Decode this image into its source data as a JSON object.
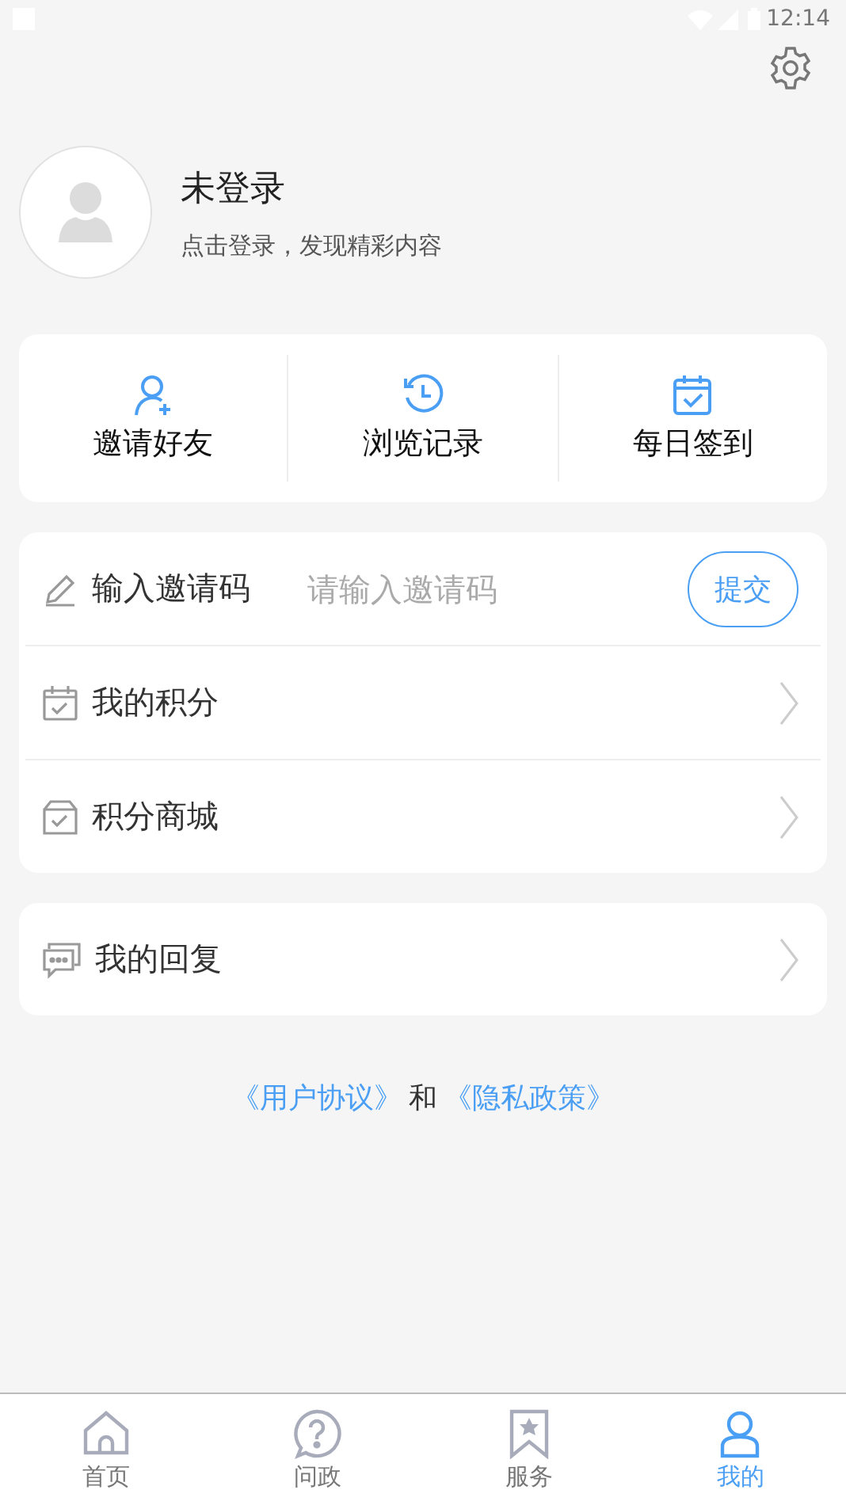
{
  "status_bar": {
    "time": "12:14"
  },
  "profile": {
    "name": "未登录",
    "subtitle": "点击登录，发现精彩内容"
  },
  "quick_actions": [
    {
      "label": "邀请好友"
    },
    {
      "label": "浏览记录"
    },
    {
      "label": "每日签到"
    }
  ],
  "menu_groups": [
    [
      {
        "kind": "input",
        "label": "输入邀请码",
        "placeholder": "请输入邀请码",
        "button": "提交"
      },
      {
        "kind": "link",
        "label": "我的积分"
      },
      {
        "kind": "link",
        "label": "积分商城"
      }
    ],
    [
      {
        "kind": "link",
        "label": "我的回复"
      }
    ]
  ],
  "agreement": {
    "first_link": "《用户协议》",
    "joiner": "和",
    "second_link": "《隐私政策》"
  },
  "tab_bar": [
    {
      "label": "首页",
      "selected": false
    },
    {
      "label": "问政",
      "selected": false
    },
    {
      "label": "服务",
      "selected": false
    },
    {
      "label": "我的",
      "selected": true
    }
  ]
}
